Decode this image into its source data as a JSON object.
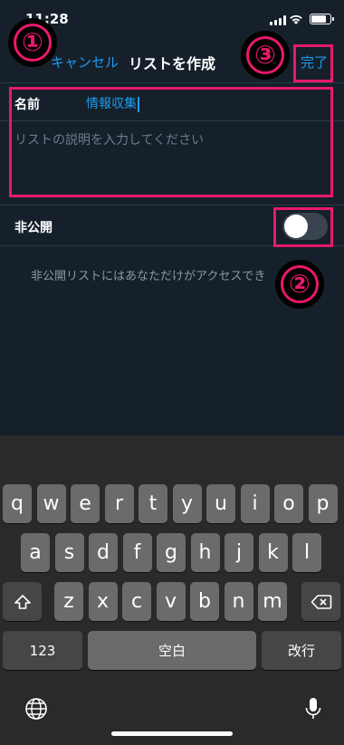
{
  "status_bar": {
    "time": "11:28"
  },
  "nav": {
    "cancel_label": "キャンセル",
    "title": "リストを作成",
    "done_label": "完了"
  },
  "form": {
    "name_label": "名前",
    "name_value": "情報収集",
    "description_placeholder": "リストの説明を入力してください",
    "private_label": "非公開",
    "private_on": false,
    "private_note": "非公開リストにはあなただけがアクセスでき"
  },
  "annotations": {
    "one": "①",
    "two": "②",
    "three": "③",
    "color": "#e8196b"
  },
  "keyboard": {
    "row1": [
      "q",
      "w",
      "e",
      "r",
      "t",
      "y",
      "u",
      "i",
      "o",
      "p"
    ],
    "row2": [
      "a",
      "s",
      "d",
      "f",
      "g",
      "h",
      "j",
      "k",
      "l"
    ],
    "row3": [
      "z",
      "x",
      "c",
      "v",
      "b",
      "n",
      "m"
    ],
    "numbers_label": "123",
    "space_label": "空白",
    "return_label": "改行"
  },
  "icons": {
    "shift": "shift-icon",
    "delete": "delete-icon",
    "globe": "globe-icon",
    "mic": "mic-icon"
  },
  "colors": {
    "accent": "#1d9bf0",
    "background": "#15202b",
    "keyboard": "#2a2a2b"
  }
}
